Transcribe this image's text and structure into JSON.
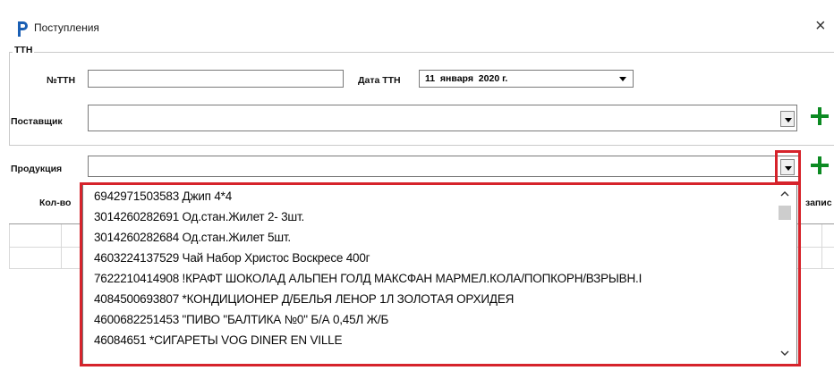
{
  "window": {
    "title": "Поступления",
    "close_glyph": "×"
  },
  "section": {
    "label": "ТТН"
  },
  "fields": {
    "ttn_number_label": "№ТТН",
    "ttn_number_value": "",
    "ttn_date_label": "Дата ТТН",
    "ttn_date_value": "11  января  2020 г.",
    "supplier_label": "Поставщик",
    "supplier_value": "",
    "product_label": "Продукция",
    "product_value": ""
  },
  "table": {
    "col_qty": "Кол-во",
    "col_partial": "запис"
  },
  "dropdown": {
    "items": [
      "6942971503583  Джип 4*4",
      "3014260282691  Од.стан.Жилет 2- 3шт.",
      "3014260282684  Од.стан.Жилет 5шт.",
      "4603224137529  Чай Набор Христос Воскресе 400г",
      "7622210414908 !КРАФТ ШОКОЛАД АЛЬПЕН ГОЛД МАКСФАН МАРМЕЛ.КОЛА/ПОПКОРН/ВЗРЫВН.I",
      "4084500693807 *КОНДИЦИОНЕР Д/БЕЛЬЯ ЛЕНОР 1Л ЗОЛОТАЯ ОРХИДЕЯ",
      "4600682251453 \"ПИВО \"БАЛТИКА №0\" Б/А 0,45Л Ж/Б",
      "46084651 *СИГАРЕТЫ VOG DINER EN VILLE"
    ]
  },
  "colors": {
    "highlight": "#d6232b",
    "plus": "#0c8a22",
    "logo": "#1a5fb4"
  },
  "icons": {
    "app_logo": "p-logo-icon",
    "add": "plus-icon",
    "dropdown": "chevron-down-icon"
  }
}
